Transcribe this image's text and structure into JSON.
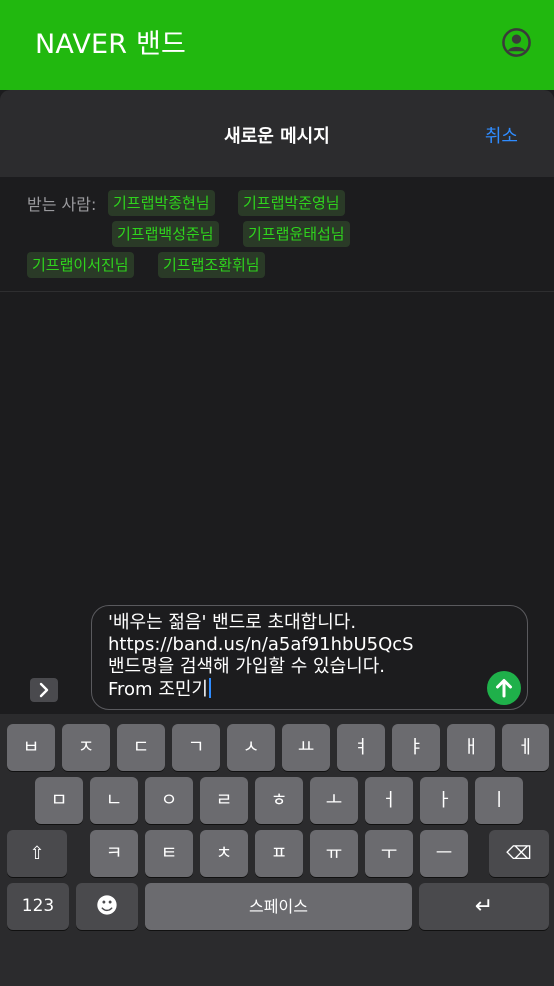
{
  "appbar": {
    "title": "NAVER 밴드"
  },
  "sheet": {
    "title": "새로운 메시지",
    "cancel": "취소"
  },
  "recipients": {
    "label": "받는 사람:",
    "names": [
      "기프랩박종현님",
      "기프랩박준영님",
      "기프랩백성준님",
      "기프랩윤태섭님",
      "기프랩이서진님",
      "기프랩조환휘님"
    ]
  },
  "message": {
    "lines": [
      "'배우는 젊음' 밴드로 초대합니다.",
      "https://band.us/n/a5af91hbU5QcS",
      "밴드명을 검색해 가입할 수 있습니다.",
      "From 조민기"
    ]
  },
  "keyboard": {
    "row1": [
      "ㅂ",
      "ㅈ",
      "ㄷ",
      "ㄱ",
      "ㅅ",
      "ㅛ",
      "ㅕ",
      "ㅑ",
      "ㅐ",
      "ㅔ"
    ],
    "row2": [
      "ㅁ",
      "ㄴ",
      "ㅇ",
      "ㄹ",
      "ㅎ",
      "ㅗ",
      "ㅓ",
      "ㅏ",
      "ㅣ"
    ],
    "row3": [
      "ㅋ",
      "ㅌ",
      "ㅊ",
      "ㅍ",
      "ㅠ",
      "ㅜ",
      "ㅡ"
    ],
    "numbers": "123",
    "space": "스페이스",
    "shift": "⇧",
    "backspace": "⌫",
    "emoji": "☻",
    "return": "↵"
  },
  "colors": {
    "brand": "#21b80f",
    "accent": "#2f8cff",
    "send": "#1fb04a"
  }
}
